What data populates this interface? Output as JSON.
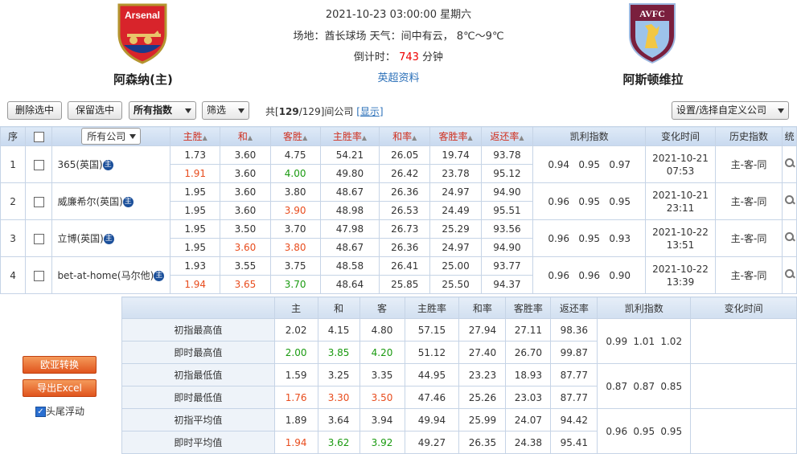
{
  "match": {
    "home": "阿森纳(主)",
    "away": "阿斯顿维拉",
    "home_crest_text": "Arsenal",
    "away_crest_text": "AVFC",
    "datetime": "2021-10-23 03:00:00 星期六",
    "venue_label": "场地：",
    "venue": "酋长球场",
    "weather_label": "天气：",
    "weather": "间中有云，",
    "temp": "8℃～9℃",
    "countdown_label": "倒计时：",
    "countdown_value": "743",
    "countdown_unit": "分钟",
    "league_link": "英超资料"
  },
  "toolbar": {
    "delete_label": "删除选中",
    "keep_label": "保留选中",
    "index_select": "所有指数",
    "filter_select": "筛选",
    "count_prefix": "共[",
    "count_shown": "129",
    "count_sep": "/",
    "count_total": "129",
    "count_suffix": "]间公司",
    "show_link": "[显示]",
    "settings_select": "设置/选择自定义公司"
  },
  "headers": {
    "seq": "序",
    "all_company": "所有公司",
    "home_win": "主胜",
    "draw": "和",
    "away_win": "客胜",
    "home_rate": "主胜率",
    "draw_rate": "和率",
    "away_rate": "客胜率",
    "return_rate": "返还率",
    "kelly": "凯利指数",
    "change_time": "变化时间",
    "history": "历史指数",
    "stat": "统"
  },
  "rows": [
    {
      "seq": "1",
      "company": "365(英国)",
      "init": [
        "1.73",
        "3.60",
        "4.75",
        "54.21",
        "26.05",
        "19.74",
        "93.78"
      ],
      "live": [
        "1.91",
        "3.60",
        "4.00",
        "49.80",
        "26.42",
        "23.78",
        "95.12"
      ],
      "live_dir": [
        "up",
        "",
        "dn"
      ],
      "kelly": [
        "0.94",
        "0.95",
        "0.97"
      ],
      "date": "2021-10-21",
      "time": "07:53",
      "history": "主-客-同"
    },
    {
      "seq": "2",
      "company": "威廉希尔(英国)",
      "init": [
        "1.95",
        "3.60",
        "3.80",
        "48.67",
        "26.36",
        "24.97",
        "94.90"
      ],
      "live": [
        "1.95",
        "3.60",
        "3.90",
        "48.98",
        "26.53",
        "24.49",
        "95.51"
      ],
      "live_dir": [
        "",
        "",
        "up"
      ],
      "kelly": [
        "0.96",
        "0.95",
        "0.95"
      ],
      "date": "2021-10-21",
      "time": "23:11",
      "history": "主-客-同"
    },
    {
      "seq": "3",
      "company": "立博(英国)",
      "init": [
        "1.95",
        "3.50",
        "3.70",
        "47.98",
        "26.73",
        "25.29",
        "93.56"
      ],
      "live": [
        "1.95",
        "3.60",
        "3.80",
        "48.67",
        "26.36",
        "24.97",
        "94.90"
      ],
      "live_dir": [
        "",
        "up",
        "up"
      ],
      "kelly": [
        "0.96",
        "0.95",
        "0.93"
      ],
      "date": "2021-10-22",
      "time": "13:51",
      "history": "主-客-同"
    },
    {
      "seq": "4",
      "company": "bet-at-home(马尔他)",
      "init": [
        "1.93",
        "3.55",
        "3.75",
        "48.58",
        "26.41",
        "25.00",
        "93.77"
      ],
      "live": [
        "1.94",
        "3.65",
        "3.70",
        "48.64",
        "25.85",
        "25.50",
        "94.37"
      ],
      "live_dir": [
        "up",
        "up",
        "dn"
      ],
      "kelly": [
        "0.96",
        "0.96",
        "0.90"
      ],
      "date": "2021-10-22",
      "time": "13:39",
      "history": "主-客-同"
    }
  ],
  "summary_headers": [
    "主",
    "和",
    "客",
    "主胜率",
    "和率",
    "客胜率",
    "返还率",
    "凯利指数",
    "变化时间"
  ],
  "summary": [
    {
      "label": "初指最高值",
      "vals": [
        "2.02",
        "4.15",
        "4.80",
        "57.15",
        "27.94",
        "27.11",
        "98.36"
      ],
      "dir": [
        "",
        "",
        ""
      ],
      "kelly": [
        "0.99",
        "1.01",
        "1.02"
      ]
    },
    {
      "label": "即时最高值",
      "vals": [
        "2.00",
        "3.85",
        "4.20",
        "51.12",
        "27.40",
        "26.70",
        "99.87"
      ],
      "dir": [
        "dn",
        "dn",
        "dn"
      ]
    },
    {
      "label": "初指最低值",
      "vals": [
        "1.59",
        "3.25",
        "3.35",
        "44.95",
        "23.23",
        "18.93",
        "87.77"
      ],
      "dir": [
        "",
        "",
        ""
      ],
      "kelly": [
        "0.87",
        "0.87",
        "0.85"
      ]
    },
    {
      "label": "即时最低值",
      "vals": [
        "1.76",
        "3.30",
        "3.50",
        "47.46",
        "25.26",
        "23.03",
        "87.77"
      ],
      "dir": [
        "up",
        "up",
        "up"
      ]
    },
    {
      "label": "初指平均值",
      "vals": [
        "1.89",
        "3.64",
        "3.94",
        "49.94",
        "25.99",
        "24.07",
        "94.42"
      ],
      "dir": [
        "",
        "",
        ""
      ],
      "kelly": [
        "0.96",
        "0.95",
        "0.95"
      ]
    },
    {
      "label": "即时平均值",
      "vals": [
        "1.94",
        "3.62",
        "3.92",
        "49.27",
        "26.35",
        "24.38",
        "95.41"
      ],
      "dir": [
        "up",
        "dn",
        "dn"
      ]
    }
  ],
  "left_panel": {
    "convert_label": "欧亚转换",
    "export_label": "导出Excel",
    "float_label": "头尾浮动"
  },
  "colors": {
    "up": "#e84c1d",
    "down": "#1a9a10",
    "header_bg": "#c8d9ef",
    "orange": "#e0541d"
  }
}
